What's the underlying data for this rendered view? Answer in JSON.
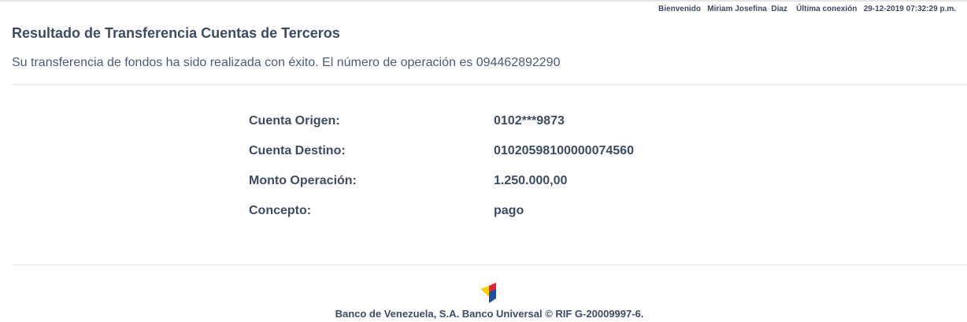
{
  "header": {
    "welcome_label": "Bienvenido",
    "user_name": "Miriam Josefina  Diaz",
    "last_login_label": "Última conexión",
    "last_login_value": "29-12-2019 07:32:29 p.m."
  },
  "result": {
    "title": "Resultado de Transferencia Cuentas de Terceros",
    "message": "Su transferencia de fondos ha sido realizada con éxito. El número de operación es 094462892290"
  },
  "details": [
    {
      "label": "Cuenta Origen:",
      "value": "0102***9873"
    },
    {
      "label": "Cuenta Destino:",
      "value": "01020598100000074560"
    },
    {
      "label": "Monto Operación:",
      "value": "1.250.000,00"
    },
    {
      "label": "Concepto:",
      "value": "pago"
    }
  ],
  "footer": {
    "text": "Banco de Venezuela, S.A. Banco Universal © RIF G-20009997-6.",
    "logo_colors": [
      "#f5d000",
      "#e3262e",
      "#1d4fa0"
    ]
  }
}
